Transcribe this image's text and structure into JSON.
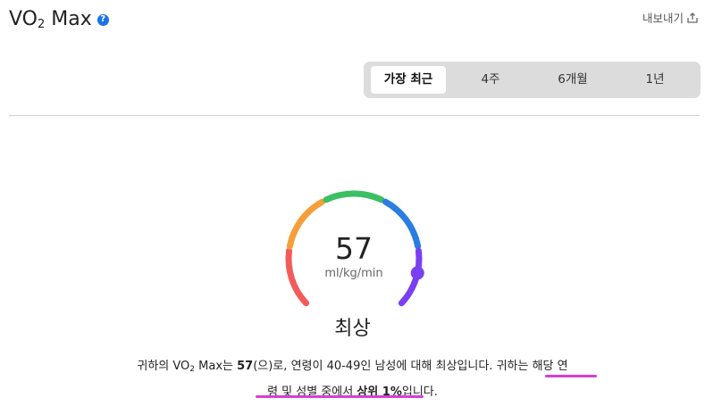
{
  "header": {
    "title_main": "VO",
    "title_sub": "2",
    "title_suffix": " Max",
    "help_icon": "question-icon",
    "export_label": "내보내기",
    "export_icon": "export-icon"
  },
  "tabs": [
    {
      "label": "가장 최근",
      "active": true
    },
    {
      "label": "4주",
      "active": false
    },
    {
      "label": "6개월",
      "active": false
    },
    {
      "label": "1년",
      "active": false
    }
  ],
  "gauge": {
    "value": "57",
    "unit": "ml/kg/min",
    "rating": "최상",
    "level": 0.88,
    "segment_colors": [
      "#f35b5b",
      "#f49f3b",
      "#3bbf62",
      "#2a7de1",
      "#7b3ff2"
    ],
    "marker_color": "#7b3ff2"
  },
  "description": {
    "p1": "귀하의 VO",
    "p1_sub": "2",
    "p2": " Max는 ",
    "value_bold": "57",
    "p3": "(으)로, 연령이 40-49인 남성에 대해 최상입니다. 귀하는 해당 연",
    "p4": "령 및 성별 중에서 ",
    "rank_bold": "상위 1%",
    "p5": "입니다.",
    "highlight_color": "#d63fd6"
  }
}
